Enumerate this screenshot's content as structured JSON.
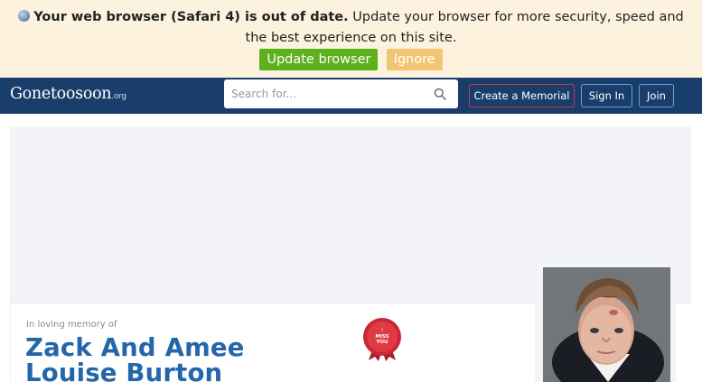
{
  "banner": {
    "headline": "Your web browser (Safari 4) is out of date.",
    "message": "Update your browser for more security, speed and the best experience on this site.",
    "update_label": "Update browser",
    "ignore_label": "Ignore",
    "update_color": "#5cb11d",
    "ignore_color": "#f1c572",
    "background": "#fdf2dd"
  },
  "header": {
    "logo_main": "Gonetoosoon",
    "logo_suffix": ".org",
    "search_placeholder": "Search for...",
    "create_label": "Create a Memorial",
    "signin_label": "Sign In",
    "join_label": "Join",
    "background": "#1a3e6c"
  },
  "memorial": {
    "in_memory_label": "In loving memory of",
    "name_line1": "Zack And Amee",
    "name_line2": "Louise Burton",
    "badge_line1": "I",
    "badge_line2": "MISS",
    "badge_line3": "YOU",
    "name_color": "#2467a8"
  }
}
